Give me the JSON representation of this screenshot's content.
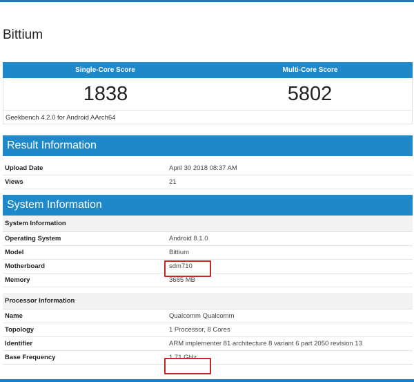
{
  "device": {
    "name": "Bittium"
  },
  "scores": {
    "single_label": "Single-Core Score",
    "multi_label": "Multi-Core Score",
    "single_value": "1838",
    "multi_value": "5802",
    "footer": "Geekbench 4.2.0 for Android AArch64"
  },
  "result_info": {
    "title": "Result Information",
    "rows": [
      {
        "key": "Upload Date",
        "value": "April 30 2018 08:37 AM"
      },
      {
        "key": "Views",
        "value": "21"
      }
    ]
  },
  "system_info": {
    "title": "System Information",
    "sub1": "System Information",
    "rows1": [
      {
        "key": "Operating System",
        "value": "Android 8.1.0"
      },
      {
        "key": "Model",
        "value": "Bittium"
      },
      {
        "key": "Motherboard",
        "value": "sdm710"
      },
      {
        "key": "Memory",
        "value": "3685 MB"
      }
    ],
    "sub2": "Processor Information",
    "rows2": [
      {
        "key": "Name",
        "value": "Qualcomm Qualcomm"
      },
      {
        "key": "Topology",
        "value": "1 Processor, 8 Cores"
      },
      {
        "key": "Identifier",
        "value": "ARM implementer 81 architecture 8 variant 6 part 2050 revision 13"
      },
      {
        "key": "Base Frequency",
        "value": "1.71 GHz"
      }
    ]
  },
  "colors": {
    "accent": "#1e88c8",
    "highlight": "#c62828"
  }
}
